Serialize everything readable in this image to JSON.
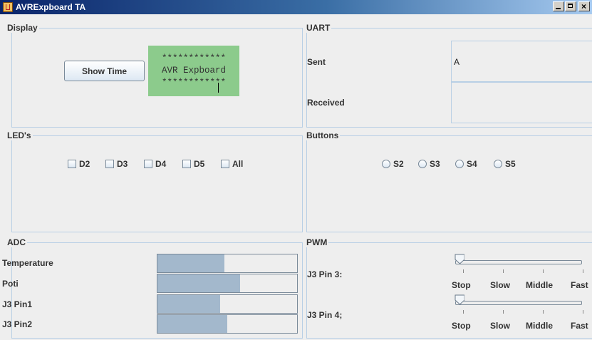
{
  "window": {
    "title": "AVRExpboard TA",
    "close_glyph": "×"
  },
  "display": {
    "title": "Display",
    "show_time_label": "Show Time",
    "lcd_lines": [
      "************",
      "AVR Expboard",
      "************"
    ]
  },
  "uart": {
    "title": "UART",
    "sent_label": "Sent",
    "sent_value": "A",
    "received_label": "Received",
    "received_value": ""
  },
  "leds": {
    "title": "LED's",
    "items": [
      {
        "label": "D2",
        "checked": false
      },
      {
        "label": "D3",
        "checked": false
      },
      {
        "label": "D4",
        "checked": false
      },
      {
        "label": "D5",
        "checked": false
      },
      {
        "label": "All",
        "checked": false
      }
    ]
  },
  "buttons": {
    "title": "Buttons",
    "items": [
      {
        "label": "S2",
        "selected": false
      },
      {
        "label": "S3",
        "selected": false
      },
      {
        "label": "S4",
        "selected": false
      },
      {
        "label": "S5",
        "selected": false
      }
    ]
  },
  "adc": {
    "title": "ADC",
    "rows": [
      {
        "label": "Temperature",
        "level": 0.48
      },
      {
        "label": "Poti",
        "level": 0.59
      },
      {
        "label": "J3 Pin1",
        "level": 0.45
      },
      {
        "label": "J3 Pin2",
        "level": 0.5
      }
    ]
  },
  "pwm": {
    "title": "PWM",
    "sliders": [
      {
        "label": "J3 Pin 3:",
        "value_index": 0
      },
      {
        "label": "J3 Pin 4;",
        "value_index": 0
      }
    ],
    "tick_labels": [
      "Stop",
      "Slow",
      "Middle",
      "Fast"
    ]
  },
  "colors": {
    "lcd_bg": "#8ccb8c",
    "bar_fill": "#a3b8cc",
    "panel_border": "#b8cfe5"
  }
}
